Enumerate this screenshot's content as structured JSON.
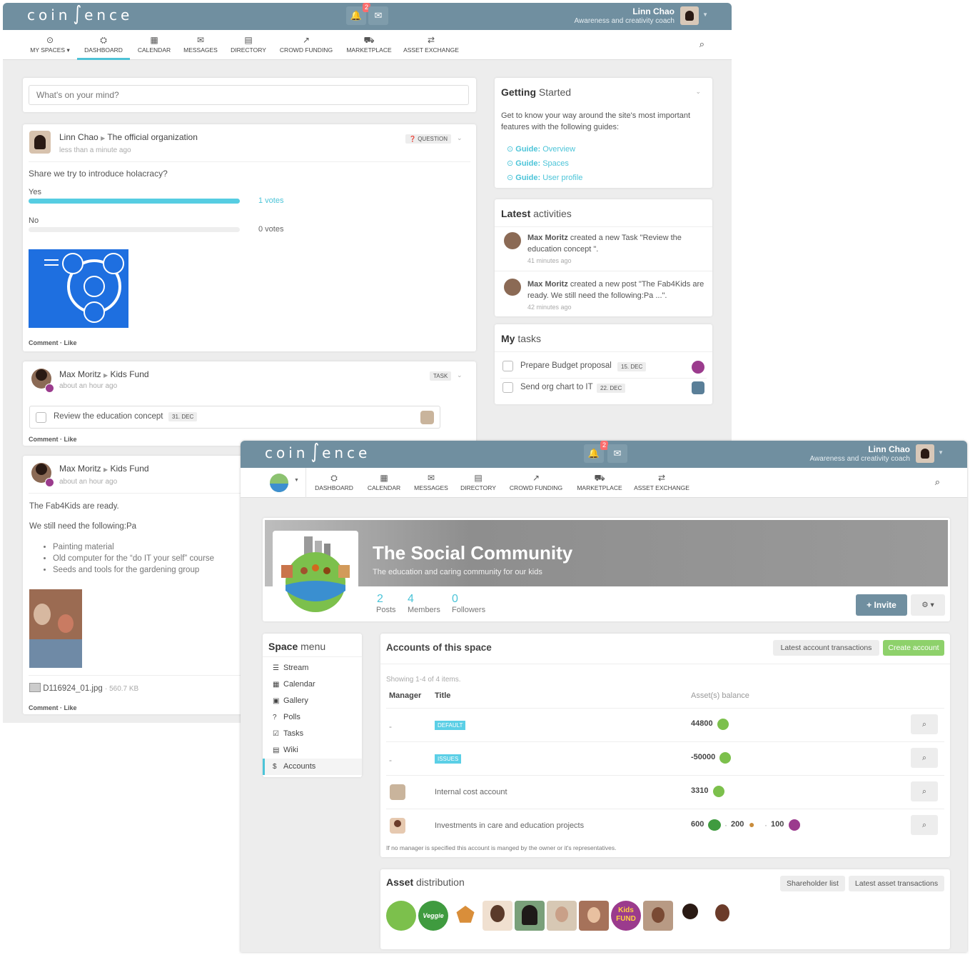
{
  "brand": {
    "logo_left": "coin",
    "logo_mid": "∫",
    "logo_right": "ence",
    "accent": "#4cc4d8",
    "topbar": "#708fa0",
    "green": "#7dc77d"
  },
  "topbar": {
    "notifications_count": "2",
    "user_name": "Linn Chao",
    "user_role": "Awareness and creativity coach"
  },
  "nav1": [
    {
      "icon": "⊙",
      "label": "MY SPACES ▾"
    },
    {
      "icon": "⛭",
      "label": "DASHBOARD"
    },
    {
      "icon": "▦",
      "label": "CALENDAR"
    },
    {
      "icon": "✉",
      "label": "MESSAGES"
    },
    {
      "icon": "▤",
      "label": "DIRECTORY"
    },
    {
      "icon": "↗",
      "label": "CROWD FUNDING"
    },
    {
      "icon": "⛟",
      "label": "MARKETPLACE"
    },
    {
      "icon": "⇄",
      "label": "ASSET EXCHANGE"
    }
  ],
  "nav2": [
    {
      "icon": "⛭",
      "label": "DASHBOARD"
    },
    {
      "icon": "▦",
      "label": "CALENDAR"
    },
    {
      "icon": "✉",
      "label": "MESSAGES"
    },
    {
      "icon": "▤",
      "label": "DIRECTORY"
    },
    {
      "icon": "↗",
      "label": "CROWD FUNDING"
    },
    {
      "icon": "⛟",
      "label": "MARKETPLACE"
    },
    {
      "icon": "⇄",
      "label": "ASSET EXCHANGE"
    }
  ],
  "composer": {
    "placeholder": "What's on your mind?"
  },
  "post1": {
    "author": "Linn Chao",
    "space": "The official organization",
    "time": "less than a minute ago",
    "tag": "QUESTION",
    "question": "Share we try to introduce holacracy?",
    "opt1": "Yes",
    "opt1_votes": "1 votes",
    "opt1_share": 1.0,
    "opt2": "No",
    "opt2_votes": "0 votes",
    "opt2_share": 0.0,
    "comment": "Comment",
    "like": "Like"
  },
  "post2": {
    "author": "Max Moritz",
    "space": "Kids Fund",
    "time": "about an hour ago",
    "tag": "TASK",
    "task": "Review the education concept",
    "due": "31. DEC",
    "comment": "Comment",
    "like": "Like"
  },
  "post3": {
    "author": "Max Moritz",
    "space": "Kids Fund",
    "time": "about an hour ago",
    "line1": "The Fab4Kids are ready.",
    "line2": "We still need the following:Pa",
    "bullets": [
      "Painting material",
      "Old computer for the “do IT your self” course",
      "Seeds and tools for the gardening group"
    ],
    "file": "D116924_01.jpg",
    "file_size": "560.7 KB",
    "comment": "Comment",
    "like": "Like"
  },
  "getting_started": {
    "title_b": "Getting",
    "title_r": "Started",
    "intro": "Get to know your way around the site's most important features with the following guides:",
    "guide_prefix": "Guide:",
    "guides": [
      "Overview",
      "Spaces",
      "User profile"
    ]
  },
  "latest": {
    "title_b": "Latest",
    "title_r": "activities",
    "items": [
      {
        "who": "Max Moritz",
        "text": "created a new Task \"Review the education concept \".",
        "time": "41 minutes ago"
      },
      {
        "who": "Max Moritz",
        "text": "created a new post \"The Fab4Kids are ready. We still need the following:Pa ...\".",
        "time": "42 minutes ago"
      }
    ]
  },
  "tasks": {
    "title_b": "My",
    "title_r": "tasks",
    "items": [
      {
        "label": "Prepare Budget proposal",
        "due": "15. DEC"
      },
      {
        "label": "Send org chart to IT",
        "due": "22. DEC"
      }
    ]
  },
  "space": {
    "name": "The Social Community",
    "desc": "The education and caring community for our kids",
    "stats": [
      {
        "n": "2",
        "l": "Posts"
      },
      {
        "n": "4",
        "l": "Members"
      },
      {
        "n": "0",
        "l": "Followers"
      }
    ],
    "invite": "+ Invite"
  },
  "space_menu": {
    "title_b": "Space",
    "title_r": "menu",
    "items": [
      {
        "icon": "☰",
        "label": "Stream"
      },
      {
        "icon": "▦",
        "label": "Calendar"
      },
      {
        "icon": "▣",
        "label": "Gallery"
      },
      {
        "icon": "?",
        "label": "Polls"
      },
      {
        "icon": "☑",
        "label": "Tasks"
      },
      {
        "icon": "▤",
        "label": "Wiki"
      },
      {
        "icon": "$",
        "label": "Accounts"
      }
    ]
  },
  "accounts": {
    "title": "Accounts of this space",
    "btn_tx": "Latest account transactions",
    "btn_create": "Create account",
    "summary": "Showing 1-4 of 4 items.",
    "cols": [
      "Manager",
      "Title",
      "Asset(s) balance"
    ],
    "rows": [
      {
        "manager": "-",
        "title": "DEFAULT",
        "badge": true,
        "balance": "44800"
      },
      {
        "manager": "-",
        "title": "ISSUES",
        "badge": true,
        "balance": "-50000"
      },
      {
        "manager": "",
        "title": "Internal cost account",
        "badge": false,
        "balance": "3310"
      },
      {
        "manager": "",
        "title": "Investments in care and education projects",
        "badge": false,
        "balance": "600",
        "extra": [
          "200",
          "100"
        ]
      }
    ],
    "footnote": "If no manager is specified this account is manged by the owner or it's representatives."
  },
  "asset_dist": {
    "title_b": "Asset",
    "title_r": "distribution",
    "btn1": "Shareholder list",
    "btn2": "Latest asset transactions",
    "veggie": "Veggie",
    "kids1": "Kids",
    "kids2": "FUND"
  }
}
